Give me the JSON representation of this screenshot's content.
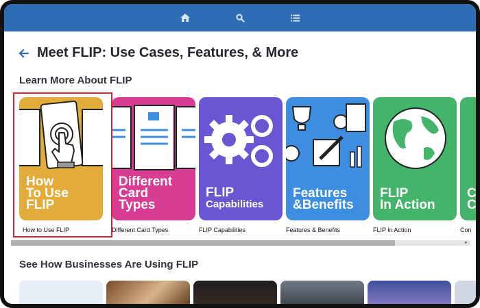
{
  "header": {
    "home_icon": "home-icon",
    "search_icon": "search-icon",
    "menu_icon": "list-icon",
    "color": "#2e6db6"
  },
  "page": {
    "title": "Meet FLIP: Use Cases, Features, & More",
    "back_icon": "arrow-left-icon"
  },
  "section1": {
    "title": "Learn More About FLIP",
    "cards": [
      {
        "label_lines": [
          "How",
          "To Use",
          "FLIP"
        ],
        "caption": "How to Use FLIP",
        "color": "#e3ac3a",
        "selected": true
      },
      {
        "label_lines": [
          "Different",
          "Card",
          "Types"
        ],
        "caption": "Different Card Types",
        "color": "#d93d93"
      },
      {
        "label_lines": [
          "FLIP",
          "Capabilities"
        ],
        "caption": "FLIP Capabilities",
        "color": "#6a55d3"
      },
      {
        "label_lines": [
          "Features",
          "&Benefits"
        ],
        "caption": "Features & Benefits",
        "color": "#3d8ee0"
      },
      {
        "label_lines": [
          "FLIP",
          "In Action"
        ],
        "caption": "FLIP in Action",
        "color": "#43b46a"
      },
      {
        "label_lines": [
          "C",
          "C"
        ],
        "caption": "Con",
        "color": "#43b46a"
      }
    ]
  },
  "section2": {
    "title": "See How Businesses Are Using FLIP"
  }
}
